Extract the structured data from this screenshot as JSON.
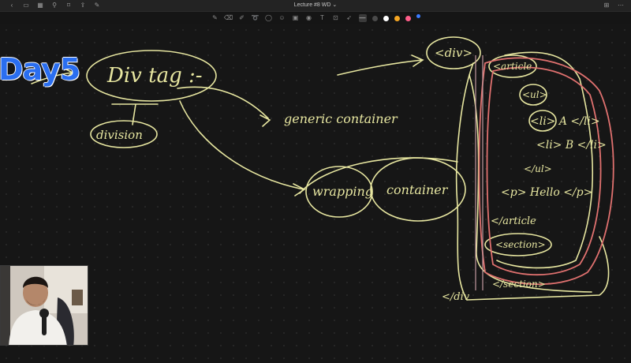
{
  "window": {
    "title": "Lecture #8 WD",
    "title_suffix": "⌄"
  },
  "toolbar": {
    "tools": [
      "pen-icon",
      "eraser-icon",
      "highlighter-icon",
      "lasso-icon",
      "shapes-icon",
      "sticker-icon",
      "image-icon",
      "camera-icon",
      "text-icon",
      "link-icon",
      "pointer-icon"
    ],
    "colors": [
      "#4a4a4a",
      "#ffffff",
      "#f5a623",
      "#ff5e8a",
      "#3b7bff"
    ]
  },
  "overlay": {
    "day_label": "Day5"
  },
  "notes": {
    "div_tag": "Div tag :-",
    "division": "division",
    "generic_container": "generic container",
    "wrapping": "wrapping",
    "container": "container",
    "div_open": "<div>",
    "article_open": "<article",
    "ul_open": "<ul>",
    "li_a": "<li> A </li>",
    "li_b": "<li> B </li>",
    "ul_close": "</ul>",
    "p_hello": "<p> Hello </p>",
    "article_close": "</article",
    "section_open": "<section>",
    "section_close": "</section>",
    "div_close": "</div"
  }
}
